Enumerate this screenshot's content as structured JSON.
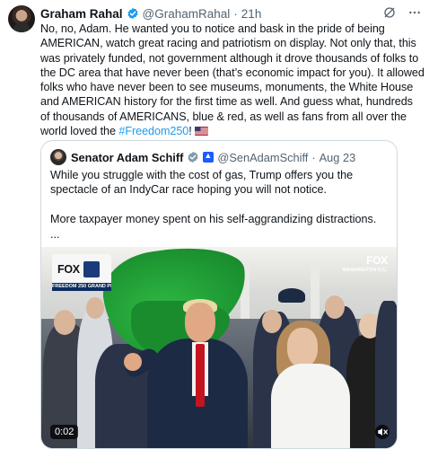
{
  "post": {
    "author_name": "Graham Rahal",
    "handle": "@GrahamRahal",
    "time_ago": "21h",
    "text_before_hashtag": "No, no, Adam. He wanted you to notice and bask in the pride of being AMERICAN, watch great racing and patriotism on display. Not only that, this was privately funded, not government although it drove thousands of folks to the DC area that have never been (that’s economic impact for you). It allowed folks who have never been to see museums, monuments, the White House and AMERICAN history for the first time as well. And guess what, hundreds of thousands of AMERICANS, blue & red, as well as fans from all over the world loved the ",
    "hashtag": "#Freedom250",
    "text_after_hashtag": "!",
    "flag_icon": "us-flag-emoji",
    "accent_color": "#1d9bf0"
  },
  "quoted": {
    "author_name": "Senator Adam Schiff",
    "handle": "@SenAdamSchiff",
    "date": "Aug 23",
    "paragraph1": "While you struggle with the cost of gas, Trump offers you the spectacle of an IndyCar race hoping you will not notice.",
    "paragraph2": "More taxpayer money spent on his self-aggrandizing distractions.",
    "ellipsis": "...",
    "video": {
      "broadcaster_left": "FOX",
      "event_banner": "FREEDOM 250 GRAND PRIX",
      "broadcaster_right": "FOX",
      "location": "WASHINGTON D.C.",
      "timecode": "0:02"
    }
  }
}
